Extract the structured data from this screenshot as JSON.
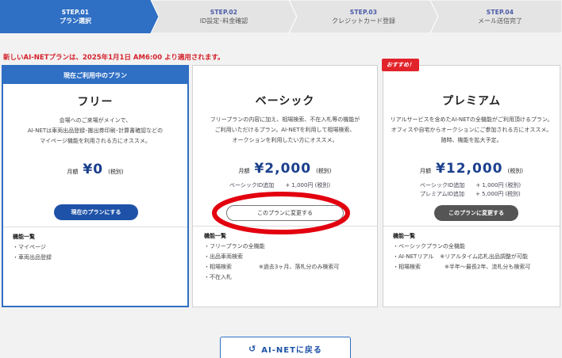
{
  "steps": [
    {
      "num": "STEP.01",
      "label": "プラン選択",
      "active": true
    },
    {
      "num": "STEP.02",
      "label": "ID設定･料金確認",
      "active": false
    },
    {
      "num": "STEP.03",
      "label": "クレジットカード登録",
      "active": false
    },
    {
      "num": "STEP.04",
      "label": "メール送信完了",
      "active": false
    }
  ],
  "notice": "新しいAI-NETプランは、2025年1月1日 AM6:00 より適用されます。",
  "colors": {
    "primary": "#1e52a8",
    "header_blue": "#2f6fc4",
    "alert_red": "#d4202a"
  },
  "plans": {
    "free": {
      "current_label": "現在ご利用中のプラン",
      "name": "フリー",
      "desc": [
        "会場へのご来場がメインで、",
        "AI-NETは車両出品登録･搬出券印刷･計算書確認などの",
        "マイページ機能を利用される方にオススメ。"
      ],
      "monthly": "月額",
      "price": "¥0",
      "tax": "(税別)",
      "button": "現在のプランにする",
      "features_title": "機能一覧",
      "features": [
        "・マイページ",
        "・車両出品登録"
      ]
    },
    "basic": {
      "name": "ベーシック",
      "desc": [
        "フリープランの内容に加え、相場検索、不在入札等の機能が",
        "ご利用いただけるプラン。AI-NETを利用して相場検索、",
        "オークションを利用したい方にオススメ。"
      ],
      "monthly": "月額",
      "price": "¥2,000",
      "tax": "(税別)",
      "addons": [
        {
          "label": "ベーシックID追加",
          "value": "+ 1,000円 (税別)"
        }
      ],
      "button": "このプランに変更する",
      "features_title": "機能一覧",
      "features": [
        {
          "text": "・フリープランの全機能",
          "note": ""
        },
        {
          "text": "・出品車両検索",
          "note": ""
        },
        {
          "text": "・相場検索",
          "note": "※過去3ヶ月、落札分のみ検索可"
        },
        {
          "text": "・不在入札",
          "note": ""
        }
      ]
    },
    "premium": {
      "badge": "おすすめ！",
      "name": "プレミアム",
      "desc": [
        "リアルサービスを含めたAI-NETの全機能がご利用頂けるプラン。",
        "オフィスや自宅からオークションにご参加される方にオススメ。",
        "随時、機能を拡大予定。"
      ],
      "monthly": "月額",
      "price": "¥12,000",
      "tax": "(税別)",
      "addons": [
        {
          "label": "ベーシックID追加",
          "value": "+ 1,000円 (税別)"
        },
        {
          "label": "プレミアムID追加",
          "value": "+ 5,000円 (税別)"
        }
      ],
      "button": "このプランに変更する",
      "features_title": "機能一覧",
      "features": [
        {
          "text": "・ベーシックプランの全機能",
          "note": ""
        },
        {
          "text": "・AI-NETリアル",
          "note": "※リアルタイム応札出品調整が可能"
        },
        {
          "text": "・相場検索",
          "note": "※半年〜最長2年、流札分も検索可"
        }
      ]
    }
  },
  "back_button": {
    "icon": "undo-icon",
    "label": "AI-NETに戻る"
  }
}
